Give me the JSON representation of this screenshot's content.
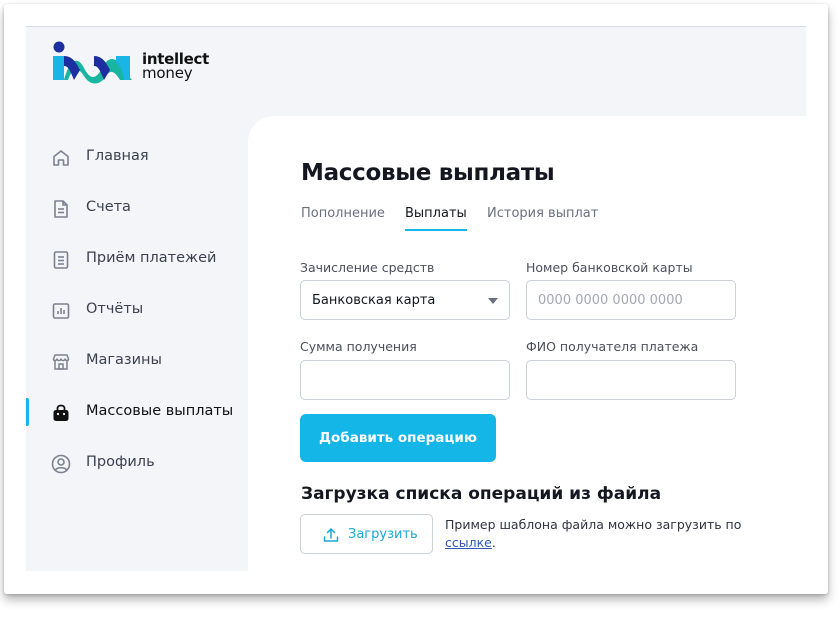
{
  "brand": {
    "name_line1": "intellect",
    "name_line2": "money"
  },
  "sidebar": {
    "items": [
      {
        "label": "Главная",
        "icon": "home-icon"
      },
      {
        "label": "Счета",
        "icon": "document-icon"
      },
      {
        "label": "Приём платежей",
        "icon": "receipt-icon"
      },
      {
        "label": "Отчёты",
        "icon": "chart-icon"
      },
      {
        "label": "Магазины",
        "icon": "store-icon"
      },
      {
        "label": "Массовые выплаты",
        "icon": "bag-icon",
        "active": true
      },
      {
        "label": "Профиль",
        "icon": "user-icon"
      }
    ]
  },
  "main": {
    "title": "Массовые выплаты",
    "tabs": [
      {
        "label": "Пополнение"
      },
      {
        "label": "Выплаты",
        "active": true
      },
      {
        "label": "История выплат"
      }
    ],
    "form": {
      "credit_label": "Зачисление средств",
      "credit_value": "Банковская карта",
      "card_label": "Номер банковской карты",
      "card_placeholder": "0000 0000 0000 0000",
      "card_value": "",
      "amount_label": "Сумма получения",
      "amount_value": "",
      "name_label": "ФИО получателя платежа",
      "name_value": "",
      "add_button": "Добавить операцию"
    },
    "upload": {
      "title": "Загрузка списка операций из файла",
      "button": "Загрузить",
      "hint_text": "Пример шаблона файла можно загрузить по ",
      "hint_link": "ссылке",
      "hint_end": "."
    }
  },
  "colors": {
    "accent": "#14b6e8",
    "sidebar_bg": "#f4f5f9",
    "link": "#2d56b8"
  }
}
